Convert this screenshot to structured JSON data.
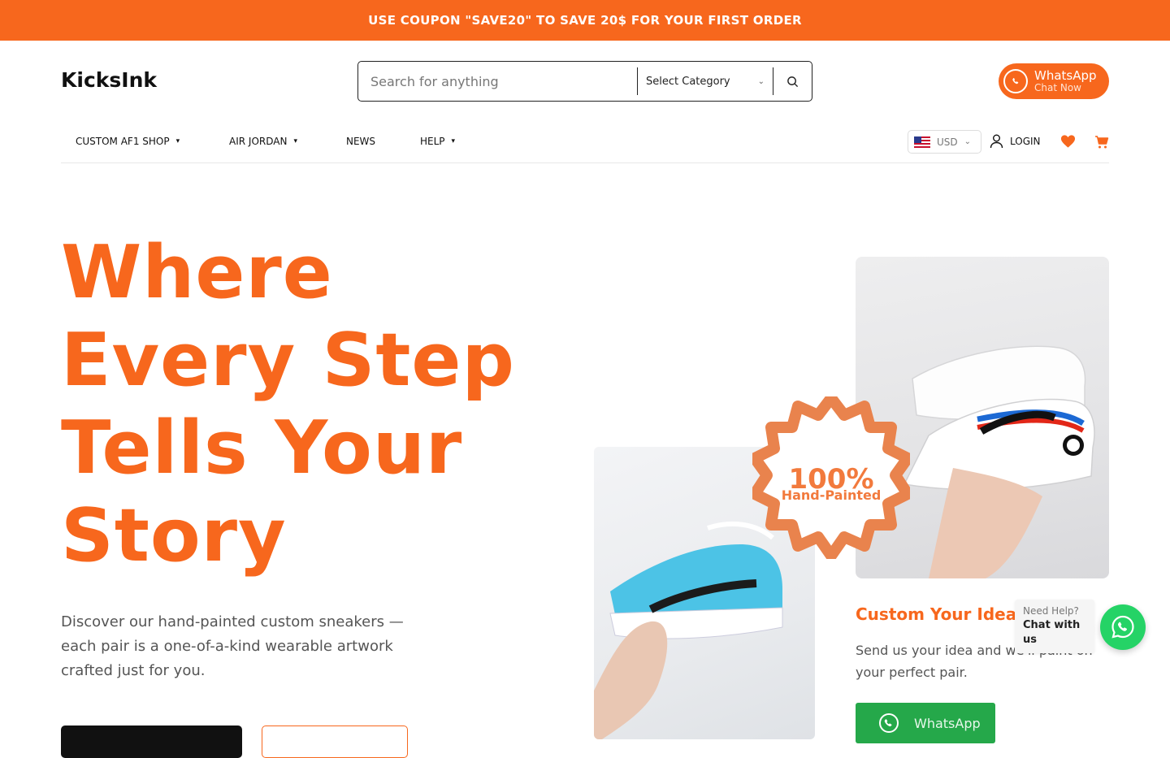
{
  "announcement": {
    "text": "USE COUPON \"SAVE20\" TO SAVE 20$ FOR YOUR FIRST ORDER"
  },
  "header": {
    "logo": "KicksInk",
    "search": {
      "placeholder": "Search for anything",
      "value": "",
      "category": "Select Category",
      "icon": "search-icon"
    },
    "whatsapp": {
      "title": "WhatsApp",
      "subtitle": "Chat Now",
      "icon": "whatsapp-icon"
    }
  },
  "nav": {
    "items": [
      {
        "label": "CUSTOM AF1 SHOP",
        "dropdown": true
      },
      {
        "label": "AIR JORDAN",
        "dropdown": true
      },
      {
        "label": "NEWS",
        "dropdown": false
      },
      {
        "label": "HELP",
        "dropdown": true
      }
    ],
    "currency": "USD",
    "login": "LOGIN",
    "icons": [
      "user-icon",
      "heart-icon",
      "cart-icon"
    ]
  },
  "hero": {
    "title_lines": [
      "Where",
      "Every Step",
      "Tells Your",
      "Story"
    ],
    "description": "Discover our hand-painted custom sneakers — each pair is a one-of-a-kind wearable artwork crafted just for you."
  },
  "badge": {
    "percent": "100%",
    "label": "Hand-Painted"
  },
  "custom": {
    "title": "Custom Your Idea",
    "description": "Send us your idea and we'll paint on your perfect pair.",
    "button": "WhatsApp"
  },
  "chat_widget": {
    "line1": "Need Help?",
    "line2": "Chat with us"
  },
  "colors": {
    "accent": "#f7671d",
    "whatsapp_green": "#25d366",
    "button_green": "#25a84a",
    "text_dark": "#111111"
  }
}
